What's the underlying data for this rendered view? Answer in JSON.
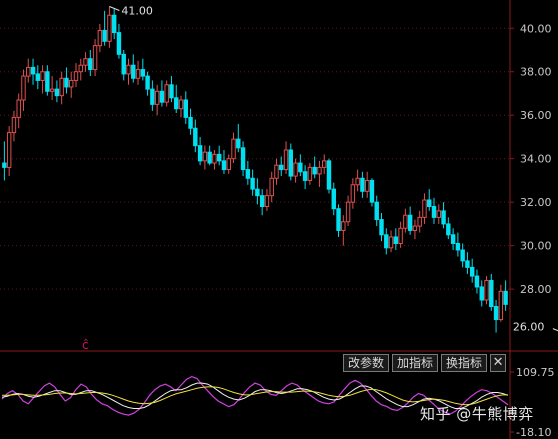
{
  "chart_data": [
    {
      "type": "candlestick",
      "title": "",
      "xlabel": "",
      "ylabel": "",
      "ylim": [
        25.2,
        41.3
      ],
      "yticks": [
        "28.00",
        "30.00",
        "32.00",
        "34.00",
        "36.00",
        "38.00",
        "40.00"
      ],
      "grid": true,
      "colors": {
        "up": "#e05050",
        "down": "#00e0f0",
        "grid": "#5a1a1a",
        "axis": "#8a1a1a"
      },
      "annotations": [
        {
          "text": "41.00",
          "value": 41.0,
          "bar": 22
        },
        {
          "text": "26.00",
          "value": 26.0,
          "bar": 117
        }
      ],
      "marker_text": "ĉ",
      "ohlc": [
        [
          33.8,
          34.8,
          33.0,
          33.6
        ],
        [
          33.6,
          35.5,
          33.2,
          35.2
        ],
        [
          35.2,
          36.2,
          34.8,
          35.9
        ],
        [
          35.9,
          37.0,
          35.4,
          36.7
        ],
        [
          36.7,
          38.1,
          36.2,
          37.8
        ],
        [
          37.8,
          38.6,
          37.5,
          38.2
        ],
        [
          38.2,
          38.6,
          37.4,
          37.9
        ],
        [
          37.9,
          38.3,
          37.2,
          37.6
        ],
        [
          37.6,
          38.3,
          37.0,
          38.0
        ],
        [
          38.0,
          38.3,
          36.9,
          37.1
        ],
        [
          37.1,
          37.8,
          36.7,
          37.2
        ],
        [
          37.2,
          37.6,
          36.6,
          36.9
        ],
        [
          36.9,
          38.0,
          36.5,
          37.7
        ],
        [
          37.7,
          38.2,
          37.0,
          37.3
        ],
        [
          37.3,
          38.0,
          36.8,
          37.6
        ],
        [
          37.6,
          38.4,
          37.3,
          38.0
        ],
        [
          38.0,
          38.6,
          37.6,
          38.3
        ],
        [
          38.3,
          38.9,
          38.0,
          38.6
        ],
        [
          38.6,
          39.0,
          37.8,
          38.1
        ],
        [
          38.1,
          39.5,
          37.8,
          39.2
        ],
        [
          39.2,
          40.2,
          38.9,
          39.9
        ],
        [
          39.9,
          40.8,
          39.2,
          39.4
        ],
        [
          39.4,
          41.0,
          39.1,
          40.6
        ],
        [
          40.6,
          40.9,
          39.5,
          39.8
        ],
        [
          39.8,
          40.2,
          38.6,
          38.8
        ],
        [
          38.8,
          39.0,
          37.6,
          37.9
        ],
        [
          37.9,
          38.6,
          37.4,
          38.3
        ],
        [
          38.3,
          38.8,
          37.5,
          37.7
        ],
        [
          37.7,
          38.5,
          37.4,
          38.1
        ],
        [
          38.1,
          38.6,
          37.6,
          37.8
        ],
        [
          37.8,
          38.0,
          36.9,
          37.2
        ],
        [
          37.2,
          37.6,
          36.2,
          36.5
        ],
        [
          36.5,
          37.4,
          36.0,
          37.1
        ],
        [
          37.1,
          37.6,
          36.4,
          36.6
        ],
        [
          36.6,
          37.6,
          36.4,
          37.4
        ],
        [
          37.4,
          37.8,
          36.6,
          36.8
        ],
        [
          36.8,
          37.4,
          36.1,
          36.3
        ],
        [
          36.3,
          36.9,
          35.9,
          36.7
        ],
        [
          36.7,
          37.1,
          35.6,
          35.9
        ],
        [
          35.9,
          36.3,
          35.1,
          35.4
        ],
        [
          35.4,
          35.8,
          34.3,
          34.6
        ],
        [
          34.6,
          35.0,
          33.7,
          33.9
        ],
        [
          33.9,
          34.6,
          33.5,
          34.3
        ],
        [
          34.3,
          34.6,
          33.7,
          33.8
        ],
        [
          33.8,
          34.4,
          33.5,
          34.2
        ],
        [
          34.2,
          34.6,
          33.7,
          33.9
        ],
        [
          33.9,
          34.4,
          33.3,
          33.5
        ],
        [
          33.5,
          34.2,
          33.3,
          34.0
        ],
        [
          34.0,
          35.2,
          33.8,
          34.9
        ],
        [
          34.9,
          35.6,
          34.3,
          34.5
        ],
        [
          34.5,
          34.8,
          33.2,
          33.5
        ],
        [
          33.5,
          33.9,
          32.8,
          33.1
        ],
        [
          33.1,
          33.5,
          32.3,
          32.6
        ],
        [
          32.6,
          33.1,
          31.9,
          32.3
        ],
        [
          32.3,
          32.6,
          31.4,
          31.8
        ],
        [
          31.8,
          32.6,
          31.6,
          32.3
        ],
        [
          32.3,
          33.4,
          32.0,
          33.1
        ],
        [
          33.1,
          34.0,
          32.8,
          33.7
        ],
        [
          33.7,
          34.1,
          33.2,
          33.5
        ],
        [
          33.5,
          34.8,
          33.3,
          34.4
        ],
        [
          34.4,
          34.7,
          33.0,
          33.2
        ],
        [
          33.2,
          34.0,
          32.9,
          33.8
        ],
        [
          33.8,
          34.2,
          33.2,
          33.4
        ],
        [
          33.4,
          33.7,
          32.6,
          33.0
        ],
        [
          33.0,
          33.8,
          32.8,
          33.6
        ],
        [
          33.6,
          34.1,
          33.1,
          33.3
        ],
        [
          33.3,
          33.9,
          32.7,
          33.6
        ],
        [
          33.6,
          34.2,
          33.3,
          33.9
        ],
        [
          33.9,
          34.0,
          32.4,
          32.6
        ],
        [
          32.6,
          32.9,
          31.4,
          31.7
        ],
        [
          31.7,
          31.9,
          30.4,
          30.7
        ],
        [
          30.7,
          31.4,
          30.0,
          31.1
        ],
        [
          31.1,
          32.3,
          30.9,
          32.0
        ],
        [
          32.0,
          33.1,
          31.7,
          32.8
        ],
        [
          32.8,
          33.5,
          32.5,
          33.1
        ],
        [
          33.1,
          33.4,
          32.2,
          32.5
        ],
        [
          32.5,
          33.4,
          32.2,
          33.0
        ],
        [
          33.0,
          33.1,
          31.8,
          32.0
        ],
        [
          32.0,
          32.3,
          30.9,
          31.2
        ],
        [
          31.2,
          31.5,
          30.2,
          30.5
        ],
        [
          30.5,
          30.8,
          29.6,
          29.9
        ],
        [
          29.9,
          30.7,
          29.7,
          30.4
        ],
        [
          30.4,
          30.8,
          29.8,
          30.1
        ],
        [
          30.1,
          31.1,
          29.9,
          30.8
        ],
        [
          30.8,
          31.7,
          30.6,
          31.4
        ],
        [
          31.4,
          31.8,
          30.5,
          30.7
        ],
        [
          30.7,
          31.2,
          30.3,
          30.9
        ],
        [
          30.9,
          31.6,
          30.6,
          31.3
        ],
        [
          31.3,
          32.4,
          31.0,
          32.1
        ],
        [
          32.1,
          32.6,
          31.6,
          31.8
        ],
        [
          31.8,
          32.2,
          31.0,
          31.3
        ],
        [
          31.3,
          31.9,
          31.0,
          31.6
        ],
        [
          31.6,
          32.0,
          30.8,
          31.0
        ],
        [
          31.0,
          31.3,
          30.3,
          30.5
        ],
        [
          30.5,
          30.8,
          29.8,
          30.1
        ],
        [
          30.1,
          30.6,
          29.5,
          29.8
        ],
        [
          29.8,
          30.1,
          29.0,
          29.3
        ],
        [
          29.3,
          29.7,
          28.7,
          29.0
        ],
        [
          29.0,
          29.4,
          28.3,
          28.6
        ],
        [
          28.6,
          28.9,
          27.8,
          28.1
        ],
        [
          28.1,
          28.4,
          27.2,
          27.5
        ],
        [
          27.5,
          28.6,
          27.3,
          28.4
        ],
        [
          28.4,
          28.7,
          27.0,
          27.2
        ],
        [
          27.2,
          27.5,
          26.0,
          26.6
        ],
        [
          26.6,
          28.2,
          26.5,
          27.9
        ],
        [
          27.9,
          28.4,
          27.0,
          27.3
        ]
      ]
    },
    {
      "type": "line",
      "title": "",
      "ylim": [
        -18.1,
        109.75
      ],
      "yticks": [
        "109.75",
        "-18.10"
      ],
      "series": [
        {
          "color": "#d040e0",
          "width": 1.2,
          "values": [
            52,
            64,
            70,
            62,
            48,
            42,
            55,
            68,
            80,
            86,
            78,
            62,
            48,
            55,
            72,
            84,
            78,
            62,
            50,
            42,
            38,
            30,
            24,
            20,
            18,
            22,
            30,
            44,
            60,
            72,
            80,
            84,
            78,
            70,
            82,
            94,
            100,
            96,
            82,
            70,
            58,
            48,
            42,
            36,
            40,
            52,
            66,
            78,
            86,
            82,
            70,
            62,
            60,
            70,
            80,
            86,
            82,
            72,
            64,
            56,
            48,
            44,
            42,
            46,
            60,
            74,
            86,
            92,
            86,
            74,
            60,
            48,
            40,
            36,
            30,
            28,
            34,
            44,
            56,
            64,
            60,
            50,
            40,
            30,
            24,
            20,
            26,
            36,
            48,
            58,
            66,
            72,
            70,
            64,
            56,
            48,
            40
          ]
        },
        {
          "color": "#f0f0f0",
          "width": 1.0,
          "values": [
            56,
            58,
            62,
            64,
            62,
            58,
            56,
            58,
            62,
            66,
            70,
            70,
            66,
            62,
            62,
            66,
            70,
            70,
            66,
            62,
            56,
            50,
            44,
            38,
            34,
            32,
            32,
            34,
            40,
            48,
            56,
            64,
            70,
            72,
            72,
            76,
            82,
            86,
            86,
            84,
            78,
            70,
            62,
            56,
            52,
            50,
            54,
            60,
            68,
            72,
            72,
            70,
            66,
            64,
            66,
            70,
            74,
            74,
            72,
            68,
            62,
            56,
            52,
            50,
            52,
            58,
            66,
            74,
            80,
            80,
            76,
            68,
            60,
            52,
            46,
            40,
            36,
            36,
            40,
            46,
            52,
            54,
            52,
            48,
            42,
            36,
            32,
            32,
            36,
            42,
            48,
            56,
            62,
            66,
            66,
            64,
            60
          ]
        },
        {
          "color": "#f0e040",
          "width": 1.0,
          "values": [
            60,
            60,
            61,
            62,
            62,
            61,
            60,
            60,
            61,
            62,
            64,
            65,
            65,
            64,
            63,
            64,
            65,
            66,
            66,
            65,
            63,
            60,
            56,
            52,
            48,
            45,
            43,
            42,
            43,
            45,
            49,
            54,
            59,
            63,
            66,
            69,
            72,
            75,
            77,
            78,
            78,
            77,
            74,
            70,
            66,
            63,
            61,
            61,
            63,
            65,
            67,
            68,
            68,
            67,
            67,
            67,
            68,
            69,
            69,
            68,
            66,
            63,
            60,
            58,
            57,
            58,
            60,
            64,
            68,
            71,
            73,
            72,
            69,
            65,
            60,
            55,
            50,
            47,
            46,
            47,
            49,
            51,
            52,
            51,
            49,
            46,
            43,
            41,
            40,
            41,
            44,
            48,
            52,
            56,
            59,
            61,
            61
          ]
        }
      ]
    }
  ],
  "toolbar": {
    "buttons": [
      "改参数",
      "加指标",
      "换指标"
    ],
    "close": "✕"
  },
  "watermark": "知乎 @牛熊博弈"
}
